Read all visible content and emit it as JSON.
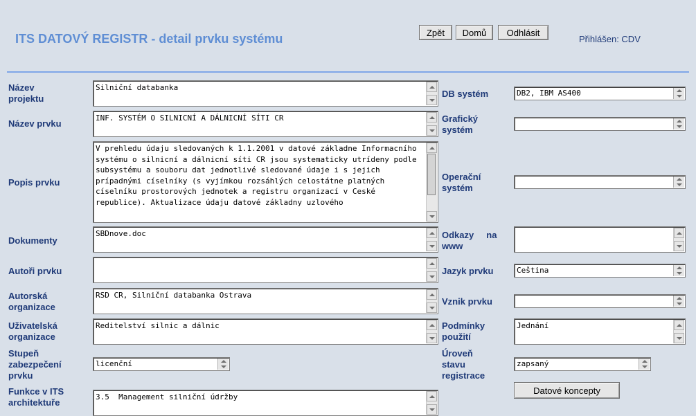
{
  "header": {
    "title": "ITS DATOVÝ REGISTR - detail prvku systému",
    "buttons": {
      "back": "Zpět",
      "home": "Domů",
      "logout": "Odhlásit"
    },
    "login": "Přihlášen:  CDV"
  },
  "left": {
    "project_name": {
      "label1": "Název",
      "label2": "projektu",
      "value": "Silniční databanka"
    },
    "element_name": {
      "label": "Název prvku",
      "value": "INF. SYSTÉM O SILNICNÍ A DÁLNICNÍ SÍTI CR"
    },
    "description": {
      "label": "Popis prvku",
      "value": "V prehledu údaju sledovaných k 1.1.2001 v datové základne Informacního systému o silnicní a dálnicní síti CR jsou systematicky utrídeny podle subsystému a souboru dat jednotlivé sledované údaje i s jejich prípadnými císelníky (s vyjímkou rozsáhlých celostátne platných císelníku prostorových jednotek a registru organizací v Ceské republice). Aktualizace údaju datové základny uzlového"
    },
    "documents": {
      "label": "Dokumenty",
      "value": "SBDnove.doc"
    },
    "authors": {
      "label": "Autoři prvku",
      "value": ""
    },
    "author_org": {
      "label1": "Autorská",
      "label2": "organizace",
      "value": "RSD CR, Silniční databanka Ostrava"
    },
    "user_org": {
      "label1": "Uživatelská",
      "label2": "organizace",
      "value": "Reditelství silnic a dálnic"
    },
    "security": {
      "label1": "Stupeň",
      "label2": "zabezpečení",
      "label3": "prvku",
      "value": "licenční"
    },
    "its_function": {
      "label1": "Funkce  v  ITS",
      "label2": "architektuře",
      "value": "3.5  Management silniční údržby"
    }
  },
  "right": {
    "db_system": {
      "label": "DB systém",
      "value": "DB2, IBM AS400"
    },
    "graphic_system": {
      "label1": "Grafický",
      "label2": "systém",
      "value": ""
    },
    "os": {
      "label1": "Operační",
      "label2": "systém",
      "value": ""
    },
    "www_links": {
      "label1": "Odkazy     na",
      "label2": "www",
      "value": ""
    },
    "language": {
      "label": "Jazyk prvku",
      "value": "Ceština"
    },
    "origin": {
      "label": "Vznik prvku",
      "value": ""
    },
    "conditions": {
      "label1": "Podmínky",
      "label2": "použití",
      "value": "Jednání"
    },
    "reg_level": {
      "label1": "Úroveň",
      "label2": "stavu",
      "label3": "registrace",
      "value": "zapsaný"
    },
    "data_concepts_button": "Datové koncepty"
  }
}
